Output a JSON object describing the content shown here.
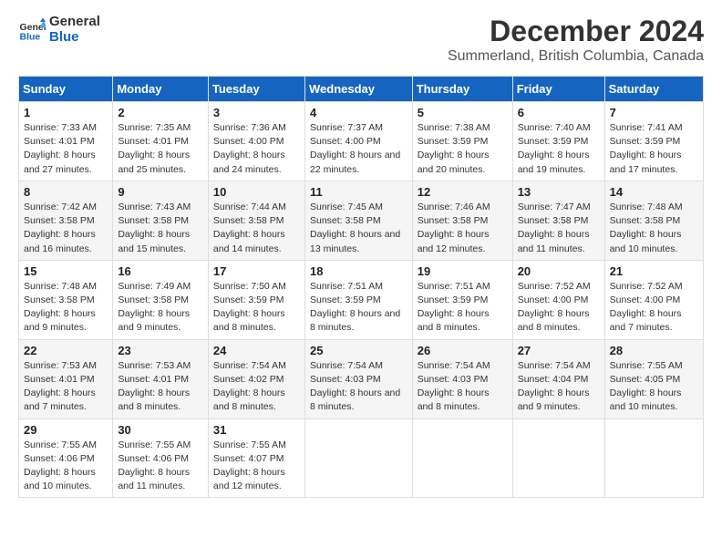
{
  "logo": {
    "line1": "General",
    "line2": "Blue"
  },
  "title": "December 2024",
  "subtitle": "Summerland, British Columbia, Canada",
  "days_of_week": [
    "Sunday",
    "Monday",
    "Tuesday",
    "Wednesday",
    "Thursday",
    "Friday",
    "Saturday"
  ],
  "weeks": [
    [
      {
        "day": "1",
        "sunrise": "7:33 AM",
        "sunset": "4:01 PM",
        "daylight": "8 hours and 27 minutes."
      },
      {
        "day": "2",
        "sunrise": "7:35 AM",
        "sunset": "4:01 PM",
        "daylight": "8 hours and 25 minutes."
      },
      {
        "day": "3",
        "sunrise": "7:36 AM",
        "sunset": "4:00 PM",
        "daylight": "8 hours and 24 minutes."
      },
      {
        "day": "4",
        "sunrise": "7:37 AM",
        "sunset": "4:00 PM",
        "daylight": "8 hours and 22 minutes."
      },
      {
        "day": "5",
        "sunrise": "7:38 AM",
        "sunset": "3:59 PM",
        "daylight": "8 hours and 20 minutes."
      },
      {
        "day": "6",
        "sunrise": "7:40 AM",
        "sunset": "3:59 PM",
        "daylight": "8 hours and 19 minutes."
      },
      {
        "day": "7",
        "sunrise": "7:41 AM",
        "sunset": "3:59 PM",
        "daylight": "8 hours and 17 minutes."
      }
    ],
    [
      {
        "day": "8",
        "sunrise": "7:42 AM",
        "sunset": "3:58 PM",
        "daylight": "8 hours and 16 minutes."
      },
      {
        "day": "9",
        "sunrise": "7:43 AM",
        "sunset": "3:58 PM",
        "daylight": "8 hours and 15 minutes."
      },
      {
        "day": "10",
        "sunrise": "7:44 AM",
        "sunset": "3:58 PM",
        "daylight": "8 hours and 14 minutes."
      },
      {
        "day": "11",
        "sunrise": "7:45 AM",
        "sunset": "3:58 PM",
        "daylight": "8 hours and 13 minutes."
      },
      {
        "day": "12",
        "sunrise": "7:46 AM",
        "sunset": "3:58 PM",
        "daylight": "8 hours and 12 minutes."
      },
      {
        "day": "13",
        "sunrise": "7:47 AM",
        "sunset": "3:58 PM",
        "daylight": "8 hours and 11 minutes."
      },
      {
        "day": "14",
        "sunrise": "7:48 AM",
        "sunset": "3:58 PM",
        "daylight": "8 hours and 10 minutes."
      }
    ],
    [
      {
        "day": "15",
        "sunrise": "7:48 AM",
        "sunset": "3:58 PM",
        "daylight": "8 hours and 9 minutes."
      },
      {
        "day": "16",
        "sunrise": "7:49 AM",
        "sunset": "3:58 PM",
        "daylight": "8 hours and 9 minutes."
      },
      {
        "day": "17",
        "sunrise": "7:50 AM",
        "sunset": "3:59 PM",
        "daylight": "8 hours and 8 minutes."
      },
      {
        "day": "18",
        "sunrise": "7:51 AM",
        "sunset": "3:59 PM",
        "daylight": "8 hours and 8 minutes."
      },
      {
        "day": "19",
        "sunrise": "7:51 AM",
        "sunset": "3:59 PM",
        "daylight": "8 hours and 8 minutes."
      },
      {
        "day": "20",
        "sunrise": "7:52 AM",
        "sunset": "4:00 PM",
        "daylight": "8 hours and 8 minutes."
      },
      {
        "day": "21",
        "sunrise": "7:52 AM",
        "sunset": "4:00 PM",
        "daylight": "8 hours and 7 minutes."
      }
    ],
    [
      {
        "day": "22",
        "sunrise": "7:53 AM",
        "sunset": "4:01 PM",
        "daylight": "8 hours and 7 minutes."
      },
      {
        "day": "23",
        "sunrise": "7:53 AM",
        "sunset": "4:01 PM",
        "daylight": "8 hours and 8 minutes."
      },
      {
        "day": "24",
        "sunrise": "7:54 AM",
        "sunset": "4:02 PM",
        "daylight": "8 hours and 8 minutes."
      },
      {
        "day": "25",
        "sunrise": "7:54 AM",
        "sunset": "4:03 PM",
        "daylight": "8 hours and 8 minutes."
      },
      {
        "day": "26",
        "sunrise": "7:54 AM",
        "sunset": "4:03 PM",
        "daylight": "8 hours and 8 minutes."
      },
      {
        "day": "27",
        "sunrise": "7:54 AM",
        "sunset": "4:04 PM",
        "daylight": "8 hours and 9 minutes."
      },
      {
        "day": "28",
        "sunrise": "7:55 AM",
        "sunset": "4:05 PM",
        "daylight": "8 hours and 10 minutes."
      }
    ],
    [
      {
        "day": "29",
        "sunrise": "7:55 AM",
        "sunset": "4:06 PM",
        "daylight": "8 hours and 10 minutes."
      },
      {
        "day": "30",
        "sunrise": "7:55 AM",
        "sunset": "4:06 PM",
        "daylight": "8 hours and 11 minutes."
      },
      {
        "day": "31",
        "sunrise": "7:55 AM",
        "sunset": "4:07 PM",
        "daylight": "8 hours and 12 minutes."
      },
      null,
      null,
      null,
      null
    ]
  ],
  "labels": {
    "sunrise": "Sunrise:",
    "sunset": "Sunset:",
    "daylight": "Daylight:"
  }
}
